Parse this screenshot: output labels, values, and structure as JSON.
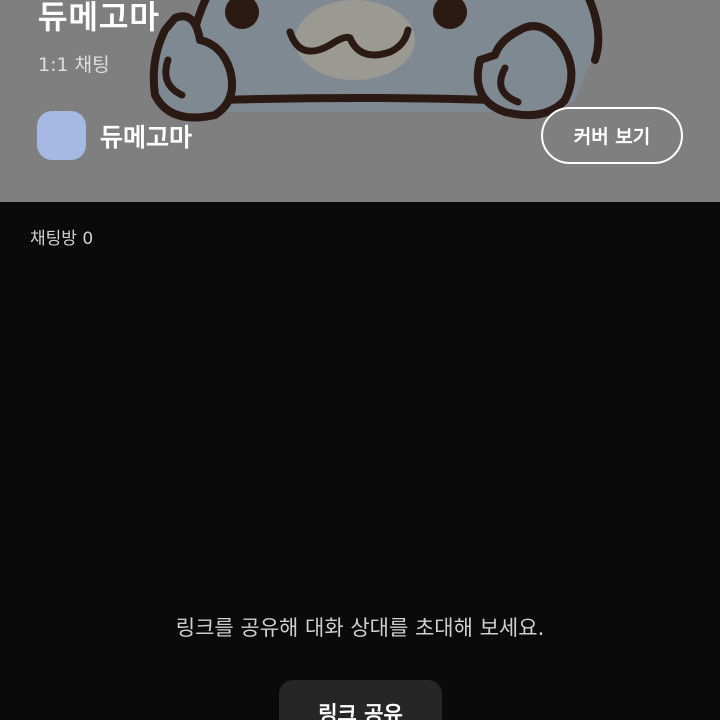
{
  "cover": {
    "title": "듀메고마",
    "type_label": "1:1 채팅",
    "owner_name": "듀메고마",
    "view_cover_label": "커버 보기",
    "avatar_color": "#a5b9e3"
  },
  "body": {
    "room_count_label": "채팅방 0",
    "empty_message": "링크를 공유해 대화 상대를 초대해 보세요.",
    "share_button_label": "링크 공유"
  }
}
